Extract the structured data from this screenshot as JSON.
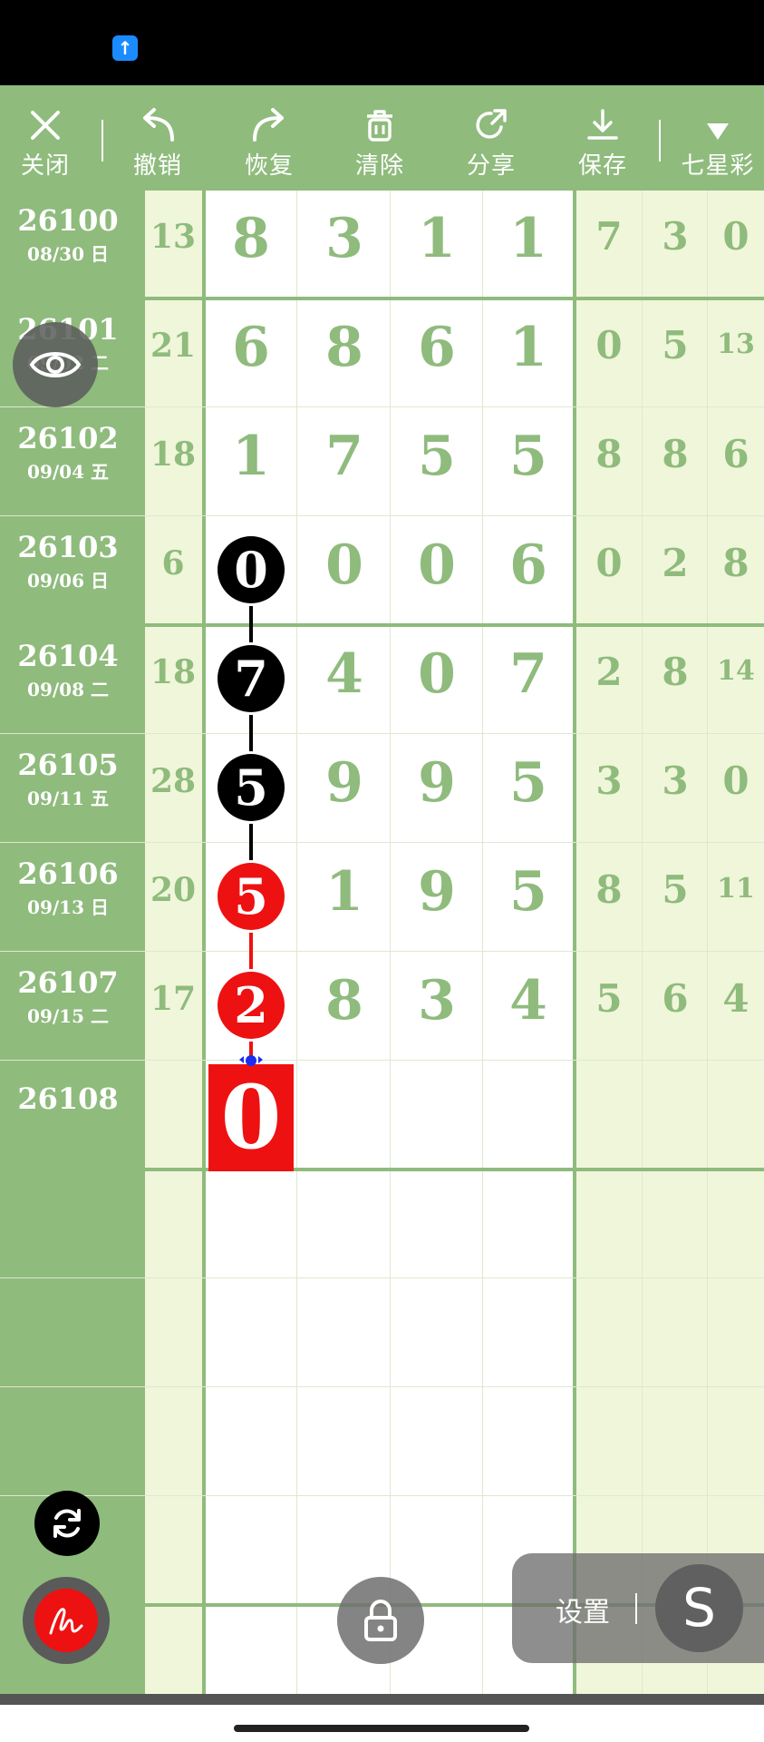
{
  "toolbar": {
    "close_label": "关闭",
    "undo_label": "撤销",
    "redo_label": "恢复",
    "clear_label": "清除",
    "share_label": "分享",
    "save_label": "保存",
    "lottery_label": "七星彩"
  },
  "rows": [
    {
      "issue": "26100",
      "date": "08/30 日",
      "sum": "13",
      "d1": "8",
      "d2": "3",
      "d3": "1",
      "d4": "1",
      "r1": "7",
      "r2": "3",
      "r3": "0"
    },
    {
      "issue": "26101",
      "date": "09/02 二",
      "sum": "21",
      "d1": "6",
      "d2": "8",
      "d3": "6",
      "d4": "1",
      "r1": "0",
      "r2": "5",
      "r3": "13"
    },
    {
      "issue": "26102",
      "date": "09/04 五",
      "sum": "18",
      "d1": "1",
      "d2": "7",
      "d3": "5",
      "d4": "5",
      "r1": "8",
      "r2": "8",
      "r3": "6"
    },
    {
      "issue": "26103",
      "date": "09/06 日",
      "sum": "6",
      "d1": "0",
      "d2": "0",
      "d3": "0",
      "d4": "6",
      "r1": "0",
      "r2": "2",
      "r3": "8"
    },
    {
      "issue": "26104",
      "date": "09/08 二",
      "sum": "18",
      "d1": "7",
      "d2": "4",
      "d3": "0",
      "d4": "7",
      "r1": "2",
      "r2": "8",
      "r3": "14"
    },
    {
      "issue": "26105",
      "date": "09/11 五",
      "sum": "28",
      "d1": "5",
      "d2": "9",
      "d3": "9",
      "d4": "5",
      "r1": "3",
      "r2": "3",
      "r3": "0"
    },
    {
      "issue": "26106",
      "date": "09/13 日",
      "sum": "20",
      "d1": "5",
      "d2": "1",
      "d3": "9",
      "d4": "5",
      "r1": "8",
      "r2": "5",
      "r3": "11"
    },
    {
      "issue": "26107",
      "date": "09/15 二",
      "sum": "17",
      "d1": "2",
      "d2": "8",
      "d3": "3",
      "d4": "4",
      "r1": "5",
      "r2": "6",
      "r3": "4"
    }
  ],
  "next_issue": "26108",
  "current_pick": "0",
  "settings_label": "设置",
  "settings_icon_letter": "S",
  "colors": {
    "green": "#8fbb7d",
    "light": "#f0f6da",
    "red": "#ee1111",
    "black": "#000000"
  }
}
